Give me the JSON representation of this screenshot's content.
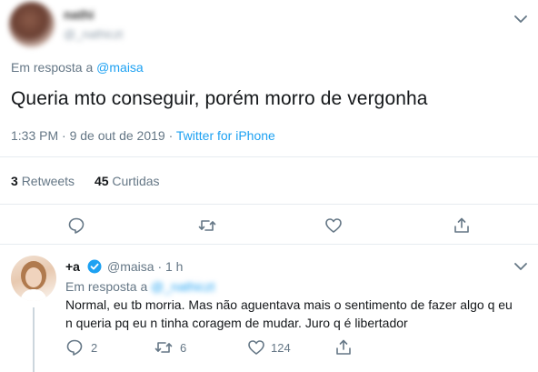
{
  "main_tweet": {
    "author_name": "nathi",
    "author_handle": "@_nathiczt",
    "reply_prefix": "Em resposta a",
    "reply_mention": "@maisa",
    "text": "Queria mto conseguir, porém morro de vergonha",
    "time": "1:33 PM · 9 de out de 2019 · ",
    "source": "Twitter for iPhone",
    "retweets_count": "3",
    "retweets_label": "Retweets",
    "likes_count": "45",
    "likes_label": "Curtidas",
    "actions": [
      "reply-icon",
      "retweet-icon",
      "like-icon",
      "share-icon"
    ]
  },
  "reply_tweet": {
    "author_name": "+a",
    "author_handle": "@maisa",
    "time": "· 1 h",
    "reply_prefix": "Em resposta a",
    "reply_mention": "@_nathiczt",
    "text": "Normal, eu tb morria. Mas não aguentava mais o sentimento de fazer algo q eu n queria pq eu n tinha coragem de mudar. Juro q é libertador",
    "reply_count": "2",
    "retweet_count": "6",
    "like_count": "124"
  },
  "colors": {
    "accent": "#1da1f2",
    "secondary_text": "#657786",
    "divider": "#e6ecf0"
  }
}
